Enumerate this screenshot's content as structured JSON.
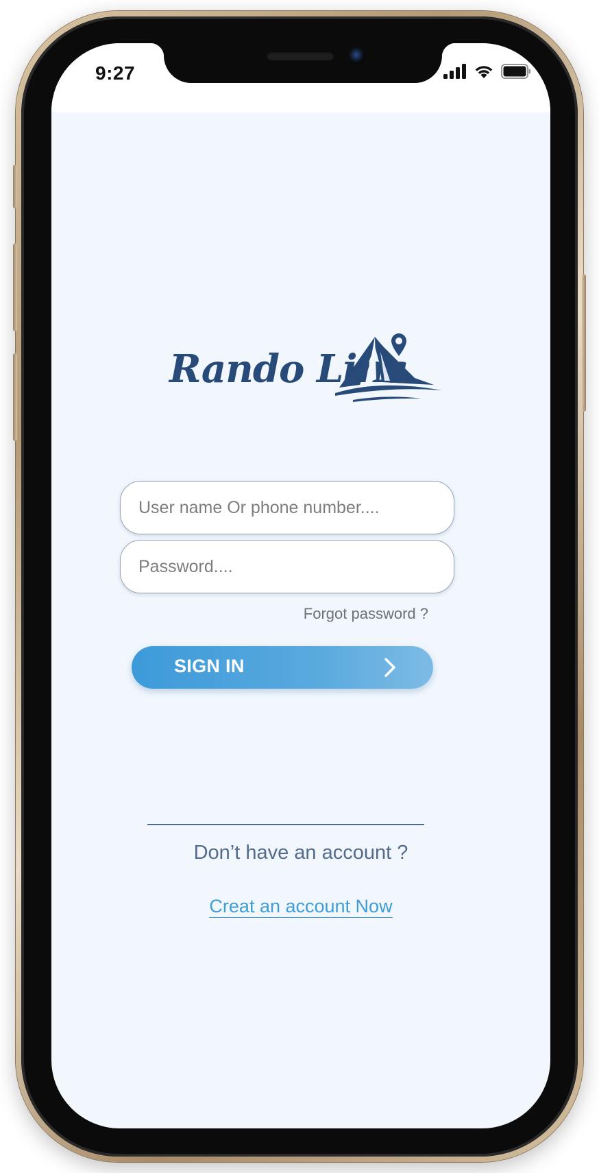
{
  "status_bar": {
    "time": "9:27",
    "icons": [
      "cellular-signal-icon",
      "wifi-icon",
      "battery-icon"
    ]
  },
  "logo": {
    "text": "Rando Lina",
    "icons": [
      "tent-icon",
      "location-pin-icon"
    ],
    "color": "#274a78"
  },
  "login_form": {
    "username_placeholder": "User name Or phone number....",
    "password_placeholder": "Password....",
    "forgot_password_label": "Forgot password ?",
    "sign_in_label": "SIGN IN"
  },
  "signup": {
    "prompt": "Don’t have an account ?",
    "link_label": "Creat an account Now"
  },
  "colors": {
    "background": "#f2f7fd",
    "accent": "#3d9ad9",
    "brand": "#274a78",
    "link": "#3f9dd6"
  }
}
